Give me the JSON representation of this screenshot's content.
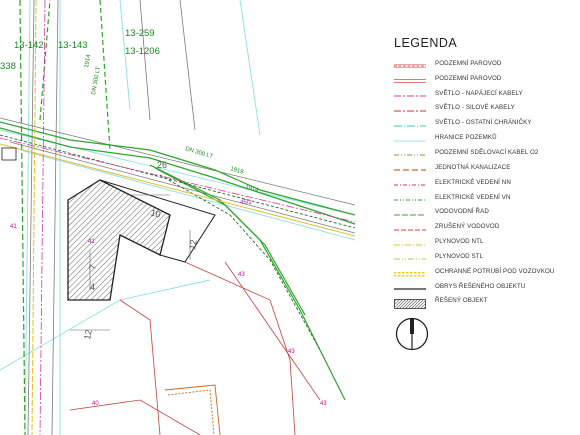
{
  "map": {
    "plan_labels": [
      {
        "id": "l1",
        "text": "13-142"
      },
      {
        "id": "l2",
        "text": "13-143"
      },
      {
        "id": "l3",
        "text": "13-259"
      },
      {
        "id": "l4",
        "text": "13-1206"
      },
      {
        "id": "l5",
        "text": "338"
      }
    ],
    "line_labels": {
      "dn_top": "DN 300 LT",
      "dn_mid": "DN 300 LT",
      "num_1914a": "1914",
      "num_1914b": "1914",
      "num_1919": "1919",
      "num_26": "26",
      "num_45": "45/1",
      "num_12a": "12",
      "num_12b": "12",
      "num_10": "10",
      "num_7": "7",
      "num_4": "4"
    },
    "parcels": {
      "p1": "43",
      "p2": "43",
      "p3": "43",
      "p4": "41",
      "p5": "41",
      "p6": "40"
    }
  },
  "legend": {
    "title": "LEGENDA",
    "items": [
      {
        "label": "PODZEMNÍ PAROVOD",
        "icon": "steam-pipe-underground",
        "color": "#d94a4a"
      },
      {
        "label": "PODZEMNÍ PAROVOD",
        "icon": "steam-pipe-underground-double",
        "color": "#d94a4a"
      },
      {
        "label": "SVĚTLO - NAPÁJECÍ KABELY",
        "icon": "light-supply-cable",
        "color": "#d23aa0"
      },
      {
        "label": "SVĚTLO - SILOVÉ KABELY",
        "icon": "light-power-cable",
        "color": "#c83030"
      },
      {
        "label": "SVĚTLO - OSTATNÍ CHRÁNIČKY",
        "icon": "light-conduit",
        "color": "#3cc7d8"
      },
      {
        "label": "HRANICE POZEMKŮ",
        "icon": "parcel-boundary",
        "color": "#9fe3ec"
      },
      {
        "label": "PODZEMNÍ SDĚLOVACÍ KABEL O2",
        "icon": "telecom-cable",
        "color": "#b08030"
      },
      {
        "label": "JEDNOTNÁ KANALIZACE",
        "icon": "sewer",
        "color": "#c86a1e"
      },
      {
        "label": "ELEKTRICKÉ VEDENÍ NN",
        "icon": "electric-low-voltage",
        "color": "#e0304a"
      },
      {
        "label": "ELEKTRICKÉ VEDENÍ VN",
        "icon": "electric-high-voltage",
        "color": "#2cae2c"
      },
      {
        "label": "VODOVODNÍ ŘAD",
        "icon": "water-main",
        "color": "#3aa03a"
      },
      {
        "label": "ZRUŠENÝ VODOVOD",
        "icon": "cancelled-water-main",
        "color": "#d8383a"
      },
      {
        "label": "PLYNOVOD NTL",
        "icon": "gas-low-pressure",
        "color": "#e0c02a"
      },
      {
        "label": "PLYNOVOD STL",
        "icon": "gas-medium-pressure",
        "color": "#d8bf30"
      },
      {
        "label": "OCHRANNÉ POTRUBÍ POD VOZOVKOU",
        "icon": "protective-pipe",
        "color": "#f0d020"
      },
      {
        "label": "OBRYS ŘEŠENÉHO OBJEKTU",
        "icon": "object-outline",
        "color": "#222222"
      },
      {
        "label": "ŘEŠENÝ OBJEKT",
        "icon": "hatched-object",
        "color": "#555555"
      }
    ]
  }
}
